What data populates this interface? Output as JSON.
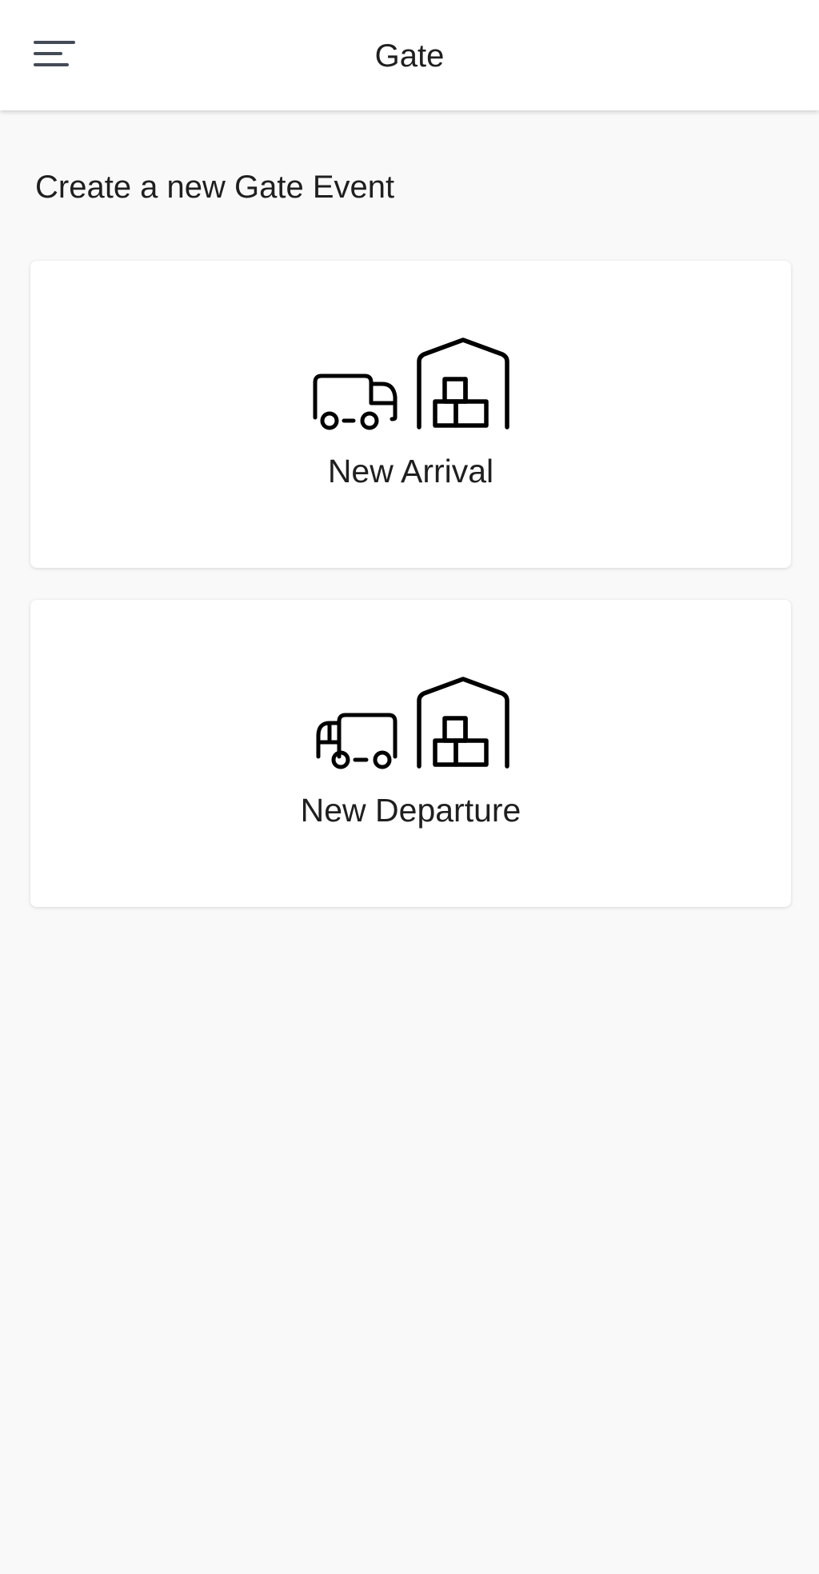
{
  "app_bar": {
    "title": "Gate",
    "menu_icon": "menu-icon"
  },
  "main": {
    "section_title": "Create a new Gate Event",
    "cards": [
      {
        "label": "New Arrival",
        "icons": [
          "truck-arriving-icon",
          "warehouse-icon"
        ]
      },
      {
        "label": "New Departure",
        "icons": [
          "truck-departing-icon",
          "warehouse-icon"
        ]
      }
    ]
  },
  "colors": {
    "background": "#f9f9f9",
    "surface": "#ffffff",
    "text": "#1f1f1f",
    "icon": "#000000",
    "menu_icon": "#444b57"
  }
}
